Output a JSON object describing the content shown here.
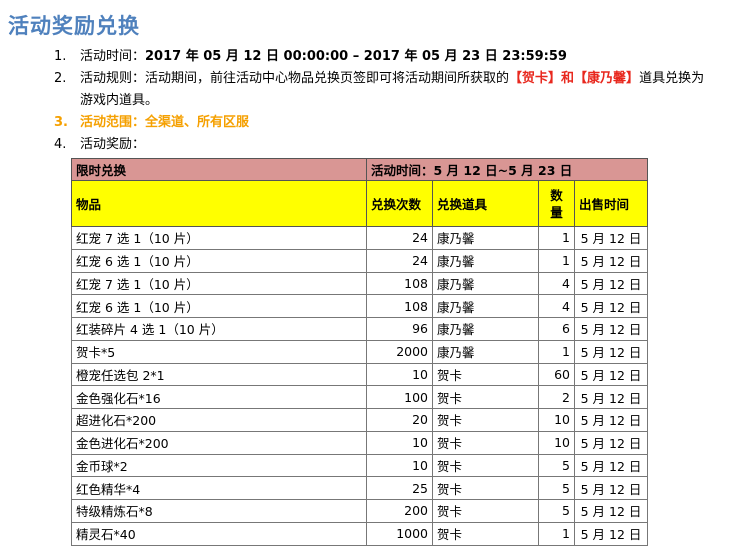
{
  "title": "活动奖励兑换",
  "items": [
    {
      "num": "1.",
      "label": "活动时间：",
      "value": "2017 年 05 月 12 日  00:00:00  –  2017 年 05 月 23 日  23:59:59"
    },
    {
      "num": "2.",
      "text_a": "活动规则：活动期间，前往活动中心物品兑换页签即可将活动期间所获取的",
      "red_a": "【贺卡】",
      "text_b": "和",
      "red_b": "【康乃馨】",
      "text_c": "道具兑换为游戏内道具。"
    },
    {
      "num": "3.",
      "text": "活动范围：全渠道、所有区服"
    },
    {
      "num": "4.",
      "text": "活动奖励："
    }
  ],
  "table": {
    "header1": {
      "left": "限时兑换",
      "right": "活动时间：5 月 12 日~5 月 23 日"
    },
    "header2": {
      "item": "物品",
      "count": "兑换次数",
      "prop": "兑换道具",
      "qty_top": "数",
      "qty_bottom": "量",
      "sale": "出售时间"
    },
    "rows": [
      {
        "item": "红宠 7 选 1（10 片）",
        "count": "24",
        "prop": "康乃馨",
        "qty": "1",
        "sale": "5 月 12 日"
      },
      {
        "item": "红宠 6 选 1（10 片）",
        "count": "24",
        "prop": "康乃馨",
        "qty": "1",
        "sale": "5 月 12 日"
      },
      {
        "item": "红宠 7 选 1（10 片）",
        "count": "108",
        "prop": "康乃馨",
        "qty": "4",
        "sale": "5 月 12 日"
      },
      {
        "item": "红宠 6 选 1（10 片）",
        "count": "108",
        "prop": "康乃馨",
        "qty": "4",
        "sale": "5 月 12 日"
      },
      {
        "item": "红装碎片 4 选 1（10 片）",
        "count": "96",
        "prop": "康乃馨",
        "qty": "6",
        "sale": "5 月 12 日"
      },
      {
        "item": "贺卡*5",
        "count": "2000",
        "prop": "康乃馨",
        "qty": "1",
        "sale": "5 月 12 日"
      },
      {
        "item": "橙宠任选包 2*1",
        "count": "10",
        "prop": "贺卡",
        "qty": "60",
        "sale": "5 月 12 日"
      },
      {
        "item": "金色强化石*16",
        "count": "100",
        "prop": "贺卡",
        "qty": "2",
        "sale": "5 月 12 日"
      },
      {
        "item": "超进化石*200",
        "count": "20",
        "prop": "贺卡",
        "qty": "10",
        "sale": "5 月 12 日"
      },
      {
        "item": "金色进化石*200",
        "count": "10",
        "prop": "贺卡",
        "qty": "10",
        "sale": "5 月 12 日"
      },
      {
        "item": "金币球*2",
        "count": "10",
        "prop": "贺卡",
        "qty": "5",
        "sale": "5 月 12 日"
      },
      {
        "item": "红色精华*4",
        "count": "25",
        "prop": "贺卡",
        "qty": "5",
        "sale": "5 月 12 日"
      },
      {
        "item": "特级精炼石*8",
        "count": "200",
        "prop": "贺卡",
        "qty": "5",
        "sale": "5 月 12 日"
      },
      {
        "item": "精灵石*40",
        "count": "1000",
        "prop": "贺卡",
        "qty": "1",
        "sale": "5 月 12 日"
      }
    ]
  },
  "colors": {
    "title": "#4f81bd",
    "orange": "#f5a000",
    "red": "#e8281e",
    "header1_bg": "#d99694",
    "header2_bg": "#ffff00"
  }
}
